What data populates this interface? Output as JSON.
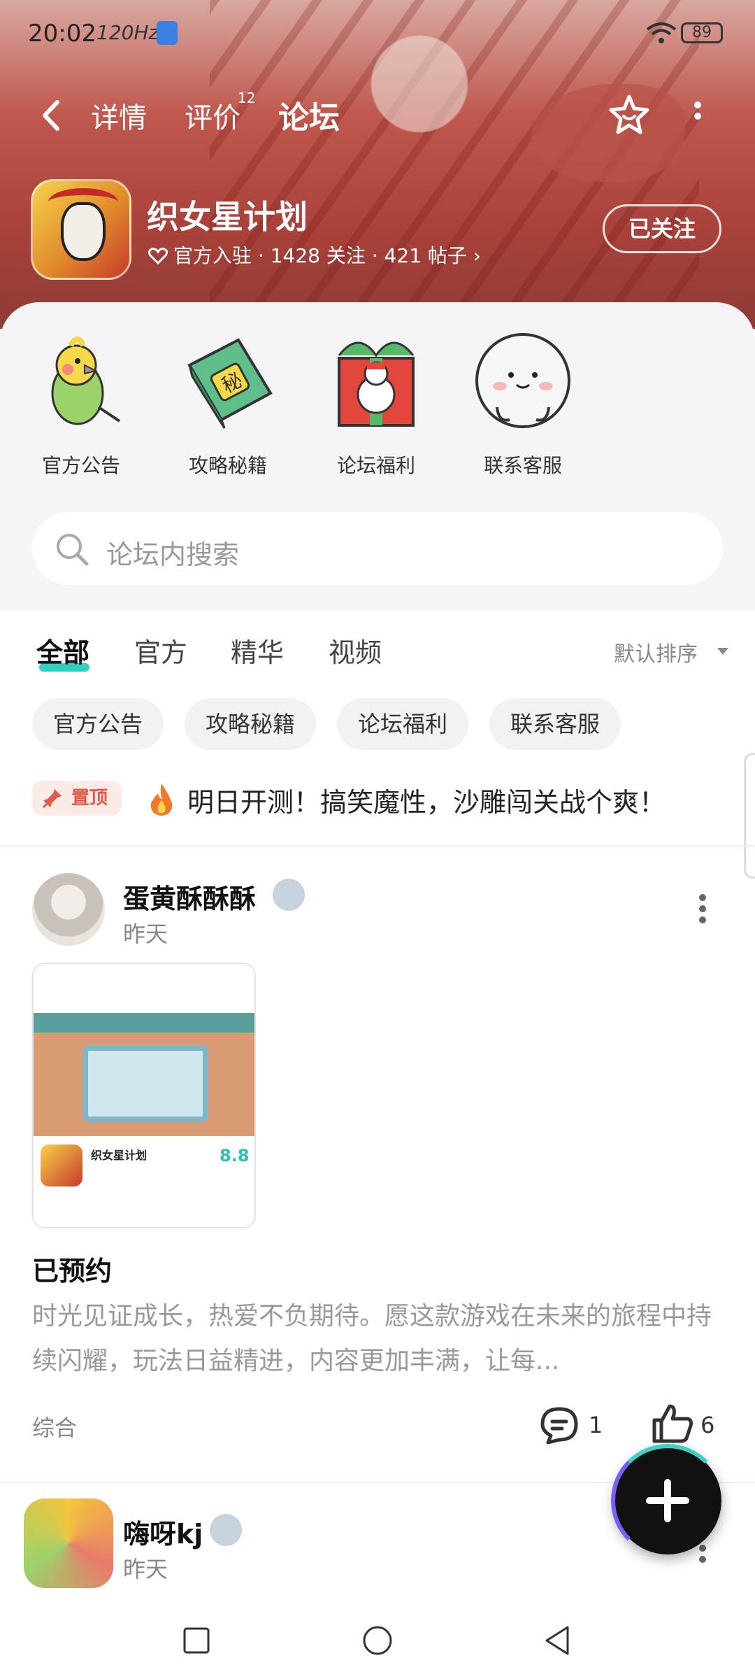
{
  "status": {
    "time": "20:02",
    "refresh": "120Hz",
    "battery": "89"
  },
  "nav": {
    "tabs": [
      "详情",
      "评价",
      "论坛"
    ],
    "review_count": "12",
    "active_tab": "论坛"
  },
  "game": {
    "name": "织女星计划",
    "meta": "官方入驻 · 1428 关注 · 421 帖子 ›",
    "follow_label": "已关注"
  },
  "quick_links": [
    {
      "label": "官方公告",
      "icon": "parrot-icon"
    },
    {
      "label": "攻略秘籍",
      "icon": "secret-book-icon"
    },
    {
      "label": "论坛福利",
      "icon": "gift-box-icon"
    },
    {
      "label": "联系客服",
      "icon": "mascot-face-icon"
    }
  ],
  "search": {
    "placeholder": "论坛内搜索"
  },
  "filter_tabs": [
    "全部",
    "官方",
    "精华",
    "视频"
  ],
  "sort_label": "默认排序",
  "chips": [
    "官方公告",
    "攻略秘籍",
    "论坛福利",
    "联系客服"
  ],
  "pinned": {
    "badge": "置顶",
    "text": "明日开测！搞笑魔性，沙雕闯关战个爽！"
  },
  "posts": [
    {
      "author": "蛋黄酥酥酥",
      "time": "昨天",
      "title": "已预约",
      "body": "时光见证成长，热爱不负期待。愿这款游戏在未来的旅程中持续闪耀，玩法日益精进，内容更加丰满，让每...",
      "tag": "综合",
      "comments": "1",
      "likes": "6",
      "preview": {
        "game_name": "织女星计划",
        "score": "8.8"
      }
    },
    {
      "author": "嗨呀kj",
      "time": "昨天"
    }
  ],
  "colors": {
    "accent": "#2ed0c4",
    "pin": "#e05a46",
    "header": "#b0473f"
  }
}
